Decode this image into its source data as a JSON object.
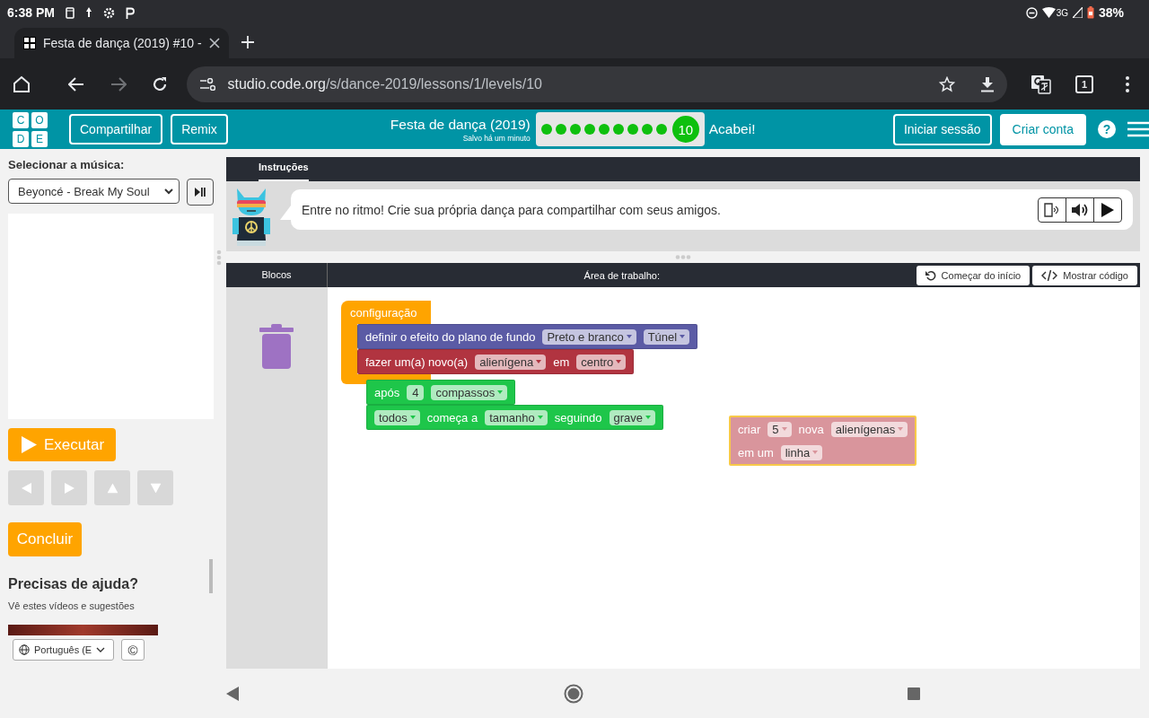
{
  "status_bar": {
    "time": "6:38 PM",
    "network": "3G",
    "battery": "38%"
  },
  "browser": {
    "tabs": [
      {
        "title": "Festa de dança (2019) #10 -",
        "selected": true
      }
    ],
    "url_host": "studio.code.org",
    "url_path": "/s/dance-2019/lessons/1/levels/10",
    "tab_count": "1"
  },
  "header": {
    "logo_letters": [
      "C",
      "O",
      "D",
      "E"
    ],
    "share_button": "Compartilhar",
    "remix_button": "Remix",
    "title": "Festa de dança (2019)",
    "save_status": "Salvo há um minuto",
    "progress": [
      {
        "completed": true
      },
      {
        "completed": true
      },
      {
        "completed": true
      },
      {
        "completed": true
      },
      {
        "completed": true
      },
      {
        "completed": true
      },
      {
        "completed": true
      },
      {
        "completed": true
      },
      {
        "completed": true
      }
    ],
    "current_level": "10",
    "finish_label": "Acabei!",
    "sign_in_button": "Iniciar sessão",
    "create_account_button": "Criar conta",
    "help_button": "?"
  },
  "left_panel": {
    "music_label": "Selecionar a música:",
    "song": "Beyoncé - Break My Soul",
    "run_button": "Executar",
    "finish_button": "Concluir",
    "help_title": "Precisas de ajuda?",
    "help_subtitle": "Vê estes vídeos e sugestões",
    "language": "Português (E",
    "copyright": "©"
  },
  "instructions": {
    "tabs": [
      {
        "label": "Instruções",
        "selected": true
      }
    ],
    "text": "Entre no ritmo! Crie sua própria dança para compartilhar com seus amigos."
  },
  "workspace": {
    "toolbox_label": "Blocos",
    "title": "Área de trabalho:",
    "reset_button": "Começar do início",
    "show_code_button": "Mostrar código",
    "stacks": [
      {
        "blocks": [
          {
            "kind": "hat",
            "color": "#ffa400",
            "selected": false,
            "rows": [
              [
                {
                  "kind": "label",
                  "text": "configuração"
                }
              ]
            ],
            "children": [
              {
                "kind": "statement",
                "color": "#5b5ba5",
                "selected": false,
                "rows": [
                  [
                    {
                      "kind": "label",
                      "text": "definir o efeito do plano de fundo"
                    },
                    {
                      "kind": "dropdown",
                      "text": "Preto e branco"
                    },
                    {
                      "kind": "dropdown",
                      "text": "Túnel"
                    }
                  ]
                ]
              },
              {
                "kind": "statement",
                "color": "#b13440",
                "selected": false,
                "rows": [
                  [
                    {
                      "kind": "label",
                      "text": "fazer um(a) novo(a)"
                    },
                    {
                      "kind": "dropdown",
                      "text": "alienígena"
                    },
                    {
                      "kind": "label",
                      "text": "em"
                    },
                    {
                      "kind": "dropdown",
                      "text": "centro"
                    }
                  ]
                ]
              }
            ]
          }
        ]
      },
      {
        "blocks": [
          {
            "kind": "statement",
            "color": "#1ec64a",
            "selected": false,
            "rows": [
              [
                {
                  "kind": "label",
                  "text": "após"
                },
                {
                  "kind": "number",
                  "text": "4"
                },
                {
                  "kind": "dropdown",
                  "text": "compassos"
                }
              ]
            ]
          },
          {
            "kind": "statement",
            "color": "#1ec64a",
            "selected": false,
            "rows": [
              [
                {
                  "kind": "dropdown",
                  "text": "todos"
                },
                {
                  "kind": "label",
                  "text": "começa a"
                },
                {
                  "kind": "dropdown",
                  "text": "tamanho"
                },
                {
                  "kind": "label",
                  "text": "seguindo"
                },
                {
                  "kind": "dropdown",
                  "text": "grave"
                }
              ]
            ]
          }
        ]
      },
      {
        "blocks": [
          {
            "kind": "statement",
            "color": "#d9959c",
            "selected": true,
            "rows": [
              [
                {
                  "kind": "label",
                  "text": "criar"
                },
                {
                  "kind": "dropdown",
                  "text": "5"
                },
                {
                  "kind": "label",
                  "text": "nova"
                },
                {
                  "kind": "dropdown",
                  "text": "alienígenas"
                }
              ],
              [
                {
                  "kind": "label",
                  "text": "em um"
                },
                {
                  "kind": "dropdown",
                  "text": "linha"
                }
              ]
            ]
          }
        ]
      }
    ]
  }
}
